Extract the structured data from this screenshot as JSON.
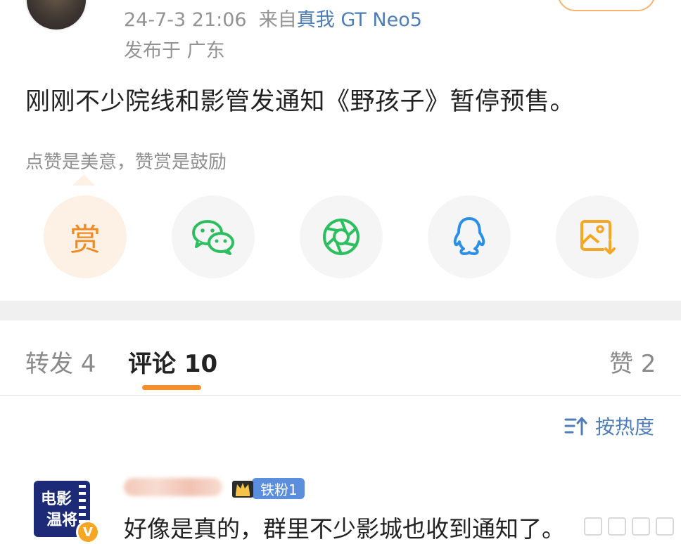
{
  "post": {
    "timestamp": "24-7-3 21:06",
    "source_prefix": "来自",
    "device": "真我 GT Neo5",
    "region": "发布于 广东",
    "text": "刚刚不少院线和影管发通知《野孩子》暂停预售。"
  },
  "reward": {
    "tip": "点赞是美意，赞赏是鼓励",
    "button_glyph": "赏"
  },
  "share_targets": [
    {
      "name": "reward",
      "icon": "reward-icon"
    },
    {
      "name": "wechat",
      "icon": "wechat-icon"
    },
    {
      "name": "moments",
      "icon": "moments-icon"
    },
    {
      "name": "qq",
      "icon": "qq-icon"
    },
    {
      "name": "save-image",
      "icon": "save-image-icon"
    }
  ],
  "tabs": {
    "repost": "转发 4",
    "comments": "评论 10",
    "likes": "赞 2"
  },
  "sort": {
    "label": "按热度"
  },
  "comment": {
    "avatar_text_1": "电影",
    "avatar_text_2": "温将",
    "verified_badge": "V",
    "fan_badge": "铁粉1",
    "text": "好像是真的，群里不少影城也收到通知了。"
  },
  "colors": {
    "accent_orange": "#f58f2a",
    "link_blue": "#4f7db6",
    "wechat_green": "#2dbe60",
    "qq_blue": "#2b8fe8",
    "save_orange": "#f5a623"
  }
}
